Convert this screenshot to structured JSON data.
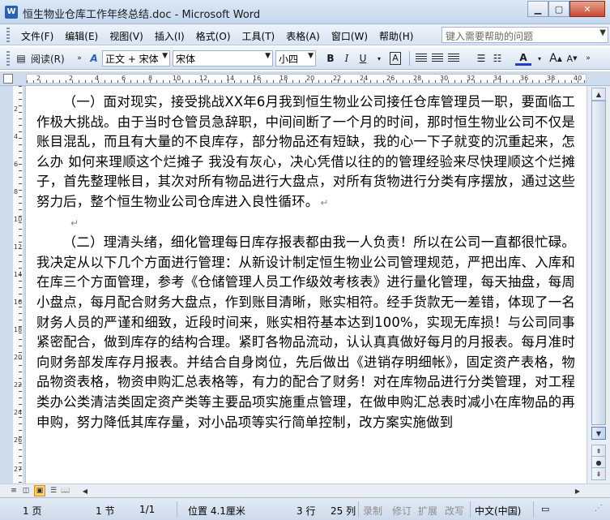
{
  "window": {
    "title": "恒生物业仓库工作年终总结.doc - Microsoft Word",
    "app_icon": "W"
  },
  "menu": {
    "items": [
      "文件(F)",
      "编辑(E)",
      "视图(V)",
      "插入(I)",
      "格式(O)",
      "工具(T)",
      "表格(A)",
      "窗口(W)",
      "帮助(H)"
    ],
    "help_placeholder": "键入需要帮助的问题"
  },
  "toolbar": {
    "reading_label": "阅读(R)",
    "style_value": "正文 + 宋体",
    "font_value": "宋体",
    "size_value": "小四",
    "bold": "B",
    "italic": "I",
    "underline": "U",
    "char_border": "A",
    "font_color": "A",
    "grow_font": "A",
    "shrink_font": "A"
  },
  "ruler": {
    "labels": [
      "2",
      "2",
      "4",
      "6",
      "8",
      "10",
      "12",
      "14",
      "16",
      "18",
      "20",
      "22",
      "24",
      "26",
      "28",
      "30",
      "32",
      "34",
      "36",
      "38",
      "40"
    ],
    "vlabels": [
      "2",
      "4",
      "6",
      "8",
      "10",
      "12",
      "14",
      "16",
      "18",
      "20",
      "22",
      "24",
      "26",
      "27"
    ]
  },
  "document": {
    "para1": "（一）面对现实，接受挑战XX年6月我到恒生物业公司接任仓库管理员一职，要面临工作极大挑战。由于当时仓管员急辞职，中间间断了一个月的时间，那时恒生物业公司不仅是账目混乱，而且有大量的不良库存，部分物品还有短缺，我的心一下子就变的沉重起来，怎么办 如何来理顺这个烂摊子 我没有灰心，决心凭借以往的的管理经验来尽快理顺这个烂摊子，首先整理帐目，其次对所有物品进行大盘点，对所有货物进行分类有序摆放，通过这些努力后，整个恒生物业公司仓库进入良性循环。",
    "para2": "（二）理清头绪，细化管理每日库存报表都由我一人负责！所以在公司一直都很忙碌。我决定从以下几个方面进行管理：从新设计制定恒生物业公司管理规范，严把出库、入库和在库三个方面管理，参考《仓储管理人员工作级效考核表》进行量化管理，每天抽盘，每周小盘点，每月配合财务大盘点，作到账目清晰，账实相符。经手货款无一差错，体现了一名财务人员的严谨和细致，近段时间来，账实相符基本达到100%，实现无库损！与公司同事紧密配合，做到库存的结构合理。紧盯各物品流动，认认真真做好每月的月报表。每月准时向财务部发库存月报表。并结合自身岗位，先后做出《进销存明细帐》，固定资产表格，物品物资表格，物资申购汇总表格等，有力的配合了财务！对在库物品进行分类管理，对工程类办公类清洁类固定资产类等主要品项实施重点管理，在做申购汇总表时减小在库物品的再申购，努力降低其库存量，对小品项等实行简单控制，改方案实施做到"
  },
  "status": {
    "page": "1 页",
    "section": "1 节",
    "pages": "1/1",
    "position": "位置 4.1厘米",
    "line": "3 行",
    "column": "25 列",
    "rec": "录制",
    "trk": "修订",
    "ext": "扩展",
    "ovr": "改写",
    "language": "中文(中国)"
  },
  "colors": {
    "accent": "#2b5fb4",
    "font_color_bar": "#1f3fbf"
  }
}
